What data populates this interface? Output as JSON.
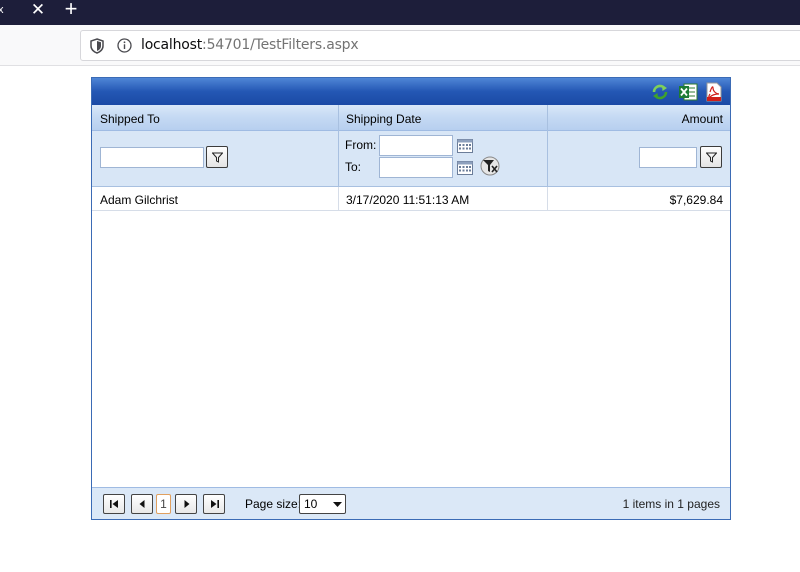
{
  "browser": {
    "tab_title": "x",
    "tab_close": "✕",
    "new_tab": "+",
    "url_host": "localhost",
    "url_rest": ":54701/TestFilters.aspx"
  },
  "grid": {
    "toolbar": {
      "icons": [
        "refresh-icon",
        "export-excel-icon",
        "export-pdf-icon"
      ]
    },
    "columns": [
      "Shipped To",
      "Shipping Date",
      "Amount"
    ],
    "filters": {
      "shipped_to_value": "",
      "from_label": "From:",
      "to_label": "To:",
      "from_value": "",
      "to_value": "",
      "amount_value": ""
    },
    "rows": [
      {
        "shipped_to": "Adam Gilchrist",
        "shipping_date": "3/17/2020 11:51:13 AM",
        "amount": "$7,629.84"
      }
    ],
    "pager": {
      "current_page": "1",
      "page_size_label": "Page size:",
      "page_size": "10",
      "info": "1 items in 1 pages"
    }
  },
  "colors": {
    "topbar": "#2457b4",
    "header": "#c4d9f3",
    "filter_row": "#d8e6f6",
    "border": "#3b6bb5"
  }
}
